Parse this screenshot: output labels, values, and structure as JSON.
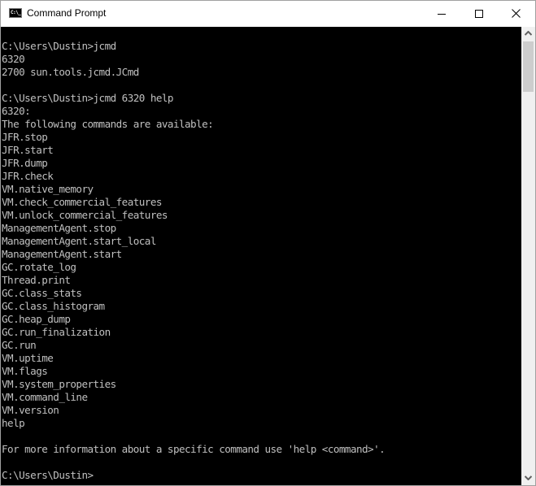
{
  "window": {
    "title": "Command Prompt",
    "icon": "cmd-icon",
    "icon_text": "C:\\_",
    "controls": [
      "minimize",
      "maximize",
      "close"
    ]
  },
  "console": {
    "lines": [
      "",
      "C:\\Users\\Dustin>jcmd",
      "6320",
      "2700 sun.tools.jcmd.JCmd",
      "",
      "C:\\Users\\Dustin>jcmd 6320 help",
      "6320:",
      "The following commands are available:",
      "JFR.stop",
      "JFR.start",
      "JFR.dump",
      "JFR.check",
      "VM.native_memory",
      "VM.check_commercial_features",
      "VM.unlock_commercial_features",
      "ManagementAgent.stop",
      "ManagementAgent.start_local",
      "ManagementAgent.start",
      "GC.rotate_log",
      "Thread.print",
      "GC.class_stats",
      "GC.class_histogram",
      "GC.heap_dump",
      "GC.run_finalization",
      "GC.run",
      "VM.uptime",
      "VM.flags",
      "VM.system_properties",
      "VM.command_line",
      "VM.version",
      "help",
      "",
      "For more information about a specific command use 'help <command>'.",
      "",
      "C:\\Users\\Dustin>"
    ]
  },
  "colors": {
    "console_bg": "#000000",
    "console_fg": "#c0c0c0",
    "titlebar_bg": "#ffffff",
    "scrollbar_track": "#f0f0f0",
    "scrollbar_thumb": "#cdcdcd"
  }
}
